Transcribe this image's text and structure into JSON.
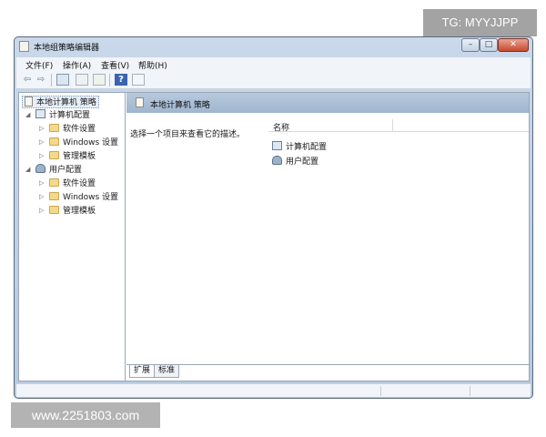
{
  "watermarks": {
    "top": "TG: MYYJJPP",
    "bottom": "www.2251803.com"
  },
  "window": {
    "title": "本地组策略编辑器",
    "buttons": {
      "minimize": "–",
      "maximize": "□",
      "close": "✕"
    }
  },
  "menu": [
    {
      "label": "文件(F)"
    },
    {
      "label": "操作(A)"
    },
    {
      "label": "查看(V)"
    },
    {
      "label": "帮助(H)"
    }
  ],
  "toolbar": {
    "icons": [
      "back-arrow-icon",
      "forward-arrow-icon",
      "show-hide-tree-icon",
      "properties-icon",
      "export-list-icon",
      "help-icon",
      "view-icon"
    ],
    "glyphs": {
      "back": "⇦",
      "forward": "⇨",
      "help": "?"
    }
  },
  "tree": {
    "root": "本地计算机 策略",
    "computer_config": {
      "label": "计算机配置",
      "children": [
        "软件设置",
        "Windows 设置",
        "管理模板"
      ]
    },
    "user_config": {
      "label": "用户配置",
      "children": [
        "软件设置",
        "Windows 设置",
        "管理模板"
      ]
    }
  },
  "right_pane": {
    "header": "本地计算机 策略",
    "description": "选择一个项目来查看它的描述。",
    "column_name": "名称",
    "items": [
      "计算机配置",
      "用户配置"
    ]
  },
  "tabs": {
    "expand": "扩展",
    "standard": "标准"
  }
}
